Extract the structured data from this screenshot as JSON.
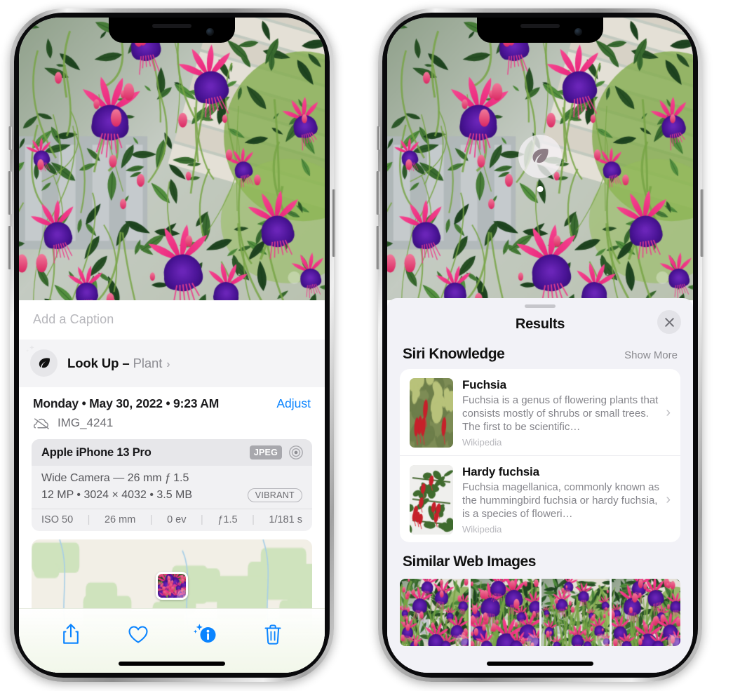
{
  "left_phone": {
    "photo": {
      "alt": "fuchsia-flowers-photo"
    },
    "caption_placeholder": "Add a Caption",
    "lookup": {
      "label": "Look Up",
      "dash": "–",
      "subject": "Plant",
      "chevron": "›",
      "icon": "leaf-icon"
    },
    "meta": {
      "date": "Monday • May 30, 2022 • 9:23 AM",
      "adjust_label": "Adjust",
      "filename": "IMG_4241",
      "cloud_icon": "cloud-slash-icon"
    },
    "camera": {
      "model": "Apple iPhone 13 Pro",
      "format_badge": "JPEG",
      "hdr_icon": "hdr-circle-icon",
      "lens_line": "Wide Camera — 26 mm ƒ 1.5",
      "size_line": "12 MP • 3024 × 4032 • 3.5 MB",
      "profile_badge": "VIBRANT",
      "exif": [
        "ISO 50",
        "26 mm",
        "0 ev",
        "ƒ1.5",
        "1/181 s"
      ]
    },
    "toolbar": [
      {
        "name": "share-button",
        "icon": "share-icon"
      },
      {
        "name": "favorite-button",
        "icon": "heart-icon"
      },
      {
        "name": "info-button",
        "icon": "info-sparkle-icon"
      },
      {
        "name": "delete-button",
        "icon": "trash-icon"
      }
    ]
  },
  "right_phone": {
    "photo": {
      "alt": "fuchsia-flowers-photo"
    },
    "leaf_badge": {
      "icon": "leaf-icon"
    },
    "sheet": {
      "title": "Results",
      "close_icon": "close-icon",
      "sections": [
        {
          "title": "Siri Knowledge",
          "action": "Show More",
          "items": [
            {
              "name": "Fuchsia",
              "description": "Fuchsia is a genus of flowering plants that consists mostly of shrubs or small trees. The first to be scientific…",
              "source": "Wikipedia",
              "chevron": "›"
            },
            {
              "name": "Hardy fuchsia",
              "description": "Fuchsia magellanica, commonly known as the hummingbird fuchsia or hardy fuchsia, is a species of floweri…",
              "source": "Wikipedia",
              "chevron": "›"
            }
          ]
        },
        {
          "title": "Similar Web Images",
          "images": [
            "web-image-1",
            "web-image-2",
            "web-image-3",
            "web-image-4"
          ]
        }
      ]
    }
  },
  "colors": {
    "accent_blue": "#0a84ff",
    "sheet_bg": "#f2f2f7",
    "card_bg": "#ffffff",
    "secondary_text": "#8a8a8f"
  }
}
